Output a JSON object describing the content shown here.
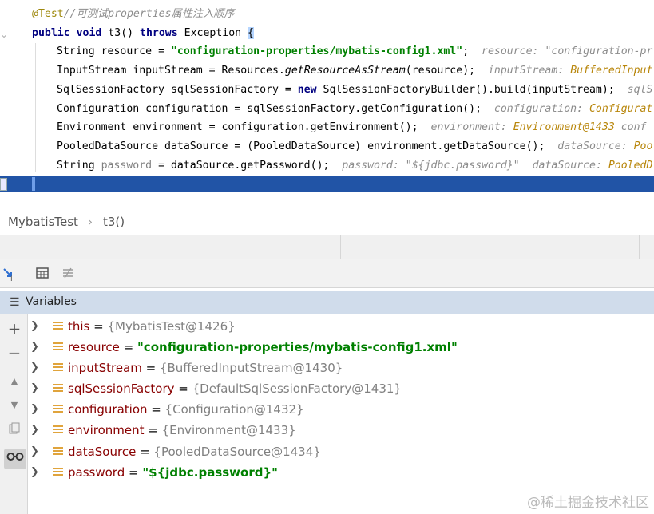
{
  "editor": {
    "annotation": "@Test",
    "comment": "//可测试properties属性注入顺序",
    "method_signature": {
      "kw1": "public",
      "kw2": "void",
      "name": "t3()",
      "kw3": "throws",
      "exception": "Exception",
      "brace": "{"
    },
    "lines": [
      {
        "type": "String",
        "var": "resource",
        "eq": " = ",
        "rhs_str": "\"configuration-properties/mybatis-config1.xml\"",
        "end": ";",
        "hint_name": "resource:",
        "hint_val": " \"configuration-pr"
      },
      {
        "type": "InputStream",
        "var": "inputStream",
        "eq": " = ",
        "rhs": "Resources.",
        "rhs_it": "getResourceAsStream",
        "rhs2": "(resource);",
        "hint_name": "inputStream:",
        "hint_val": " BufferedInput"
      },
      {
        "type": "SqlSessionFactory",
        "var": "sqlSessionFactory",
        "eq": " = ",
        "kw": "new",
        "rhs": " SqlSessionFactoryBuilder().build(inputStream);",
        "hint_name": "sqlS",
        "hint_val": ""
      },
      {
        "type": "Configuration",
        "var": "configuration",
        "eq": " = ",
        "rhs": "sqlSessionFactory.getConfiguration();",
        "hint_name": "configuration:",
        "hint_val": " Configurat"
      },
      {
        "type": "Environment",
        "var": "environment",
        "eq": " = ",
        "rhs": "configuration.getEnvironment();",
        "hint_name": "environment:",
        "hint_val": " Environment@1433",
        "hint2": " conf"
      },
      {
        "type": "PooledDataSource",
        "var": "dataSource",
        "eq": " = ",
        "rhs": "(PooledDataSource) environment.getDataSource();",
        "hint_name": "dataSource:",
        "hint_val": " Poo"
      },
      {
        "type": "String",
        "var": "password",
        "eq": " = ",
        "rhs": "dataSource.getPassword();",
        "hint_name": "password:",
        "hint_val": " \"${jdbc.password}\"",
        "hint2_name": "dataSource:",
        "hint2_val": " PooledD"
      }
    ],
    "closing_brace": "}"
  },
  "breadcrumb": {
    "class": "MybatisTest",
    "sep": "›",
    "method": "t3()"
  },
  "debugger": {
    "panel_title": "Variables",
    "variables": [
      {
        "name": "this",
        "value": "{MybatisTest@1426}",
        "kind": "object"
      },
      {
        "name": "resource",
        "value": "\"configuration-properties/mybatis-config1.xml\"",
        "kind": "string"
      },
      {
        "name": "inputStream",
        "value": "{BufferedInputStream@1430}",
        "kind": "object"
      },
      {
        "name": "sqlSessionFactory",
        "value": "{DefaultSqlSessionFactory@1431}",
        "kind": "object"
      },
      {
        "name": "configuration",
        "value": "{Configuration@1432}",
        "kind": "object"
      },
      {
        "name": "environment",
        "value": "{Environment@1433}",
        "kind": "object"
      },
      {
        "name": "dataSource",
        "value": "{PooledDataSource@1434}",
        "kind": "object"
      },
      {
        "name": "password",
        "value": "\"${jdbc.password}\"",
        "kind": "string"
      }
    ],
    "equals": " = "
  },
  "watermark": "@稀土掘金技术社区",
  "colors": {
    "exec_line": "#2154a6",
    "header": "#d0dceb",
    "string": "#008000",
    "var_name": "#880000"
  }
}
